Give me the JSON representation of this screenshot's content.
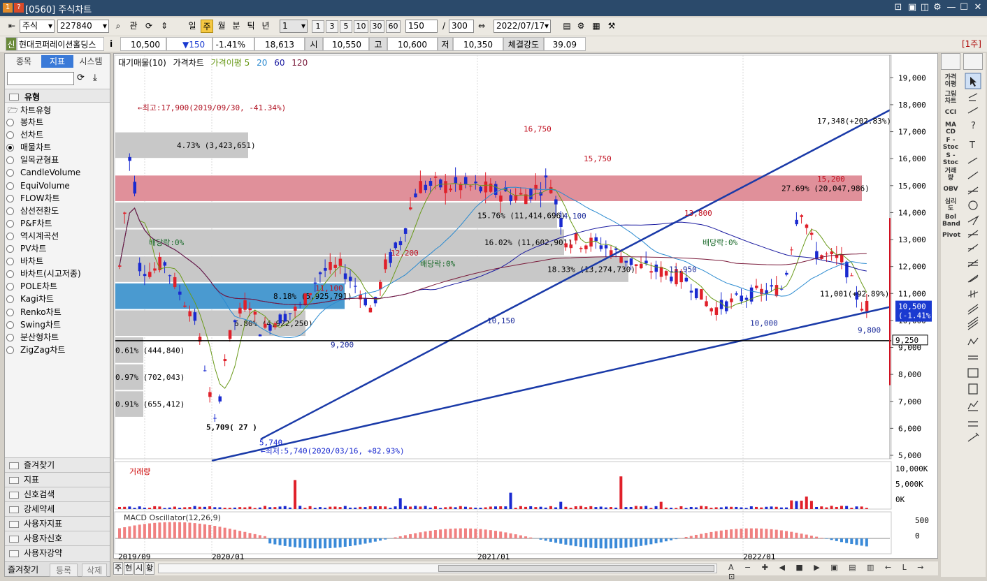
{
  "window": {
    "title": "[0560] 주식차트",
    "menu_icons": [
      "1",
      "?"
    ]
  },
  "toolbar": {
    "market": "주식",
    "code": "227840",
    "btn_gwan": "관",
    "periods": [
      "일",
      "주",
      "월",
      "분",
      "틱",
      "년"
    ],
    "active_period": "주",
    "interval_value": "1",
    "quick": [
      "1",
      "3",
      "5",
      "10",
      "30",
      "60"
    ],
    "count": "150",
    "total": "300",
    "date": "2022/07/17"
  },
  "quote": {
    "badge": "신",
    "name": "현대코퍼레이션홀딩스",
    "info": "i",
    "price": "10,500",
    "change": "▼150",
    "pct": "-1.41%",
    "volume": "18,613",
    "open_label": "시",
    "open": "10,550",
    "high_label": "고",
    "high": "10,600",
    "low_label": "저",
    "low": "10,350",
    "strength_label": "체결강도",
    "strength": "39.09",
    "period_badge": "[1주]"
  },
  "left": {
    "tabs": [
      "종목",
      "지표",
      "시스템"
    ],
    "active_tab": "지표",
    "section_title": "유형",
    "tree_root": "차트유형",
    "types": [
      "봉차트",
      "선차트",
      "매물차트",
      "일목균형표",
      "CandleVolume",
      "EquiVolume",
      "FLOW차트",
      "삼선전환도",
      "P&F차트",
      "역시계곡선",
      "PV차트",
      "바차트",
      "바차트(시고저종)",
      "POLE차트",
      "Kagi차트",
      "Renko차트",
      "Swing차트",
      "분산형차트",
      "ZigZag차트"
    ],
    "selected_type": "매물차트",
    "sections": [
      "즐겨찾기",
      "지표",
      "신호검색",
      "강세약세",
      "사용자지표",
      "사용자신호",
      "사용자강약"
    ],
    "bottom_tabs": [
      "즐겨찾기",
      "등록",
      "삭제"
    ]
  },
  "legend": {
    "items": [
      "대기매물(10)",
      "가격차트",
      "가격이평 5",
      "20",
      "60",
      "120"
    ],
    "colors": {
      "ma5": "#6a9a1a",
      "ma20": "#2a8ad0",
      "ma60": "#1a1aa0",
      "ma120": "#7a1a3a"
    }
  },
  "annotations": {
    "high": "←최고:17,900(2019/09/30, -41.34%)",
    "low": "←최저:5,740(2020/03/16, +82.93%)",
    "low_val": "5,740",
    "dividend": "배당락:0%",
    "labels": [
      "16,750",
      "15,750",
      "14,100",
      "12,200",
      "11,100",
      "9,200",
      "10,150",
      "13,800",
      "11,950",
      "10,000",
      "15,200",
      "9,800"
    ],
    "trend_top": "17,348(+202.83%)",
    "trend_low": "11,001(+92.89%)",
    "left_low": "5,709( 27 )",
    "horiz": "9,250",
    "cur_price": "10,500",
    "cur_pct": "(-1.41%)"
  },
  "volume_profile": [
    {
      "label": "4.73% (3,423,651)"
    },
    {
      "label": "27.69% (20,047,986)"
    },
    {
      "label": "15.76% (11,414,696)"
    },
    {
      "label": "16.02% (11,602,901)"
    },
    {
      "label": "18.33% (13,274,730)"
    },
    {
      "label": "8.18% (5,925,791)"
    },
    {
      "label": "6.80% (4,922,250)"
    },
    {
      "label": "0.61% (444,840)"
    },
    {
      "label": "0.97% (702,043)"
    },
    {
      "label": "0.91% (655,412)"
    }
  ],
  "price_axis": [
    "19,000",
    "18,000",
    "17,000",
    "16,000",
    "15,000",
    "14,000",
    "13,000",
    "12,000",
    "11,000",
    "10,000",
    "9,000",
    "8,000",
    "7,000",
    "6,000",
    "5,000"
  ],
  "volume_panel": {
    "title": "거래량",
    "axis": [
      "10,000K",
      "5,000K",
      "0K"
    ]
  },
  "macd_panel": {
    "title": "MACD Oscillator(12,26,9)",
    "axis": [
      "500",
      "0"
    ]
  },
  "x_axis": [
    "2019/09",
    "2020/01",
    "2021/01",
    "2022/01"
  ],
  "bottom": {
    "buttons": [
      "주",
      "현",
      "시",
      "황"
    ]
  },
  "chart_data": {
    "type": "candlestick",
    "x": [
      "2019/09",
      "2022/07"
    ],
    "y_range": [
      5000,
      19500
    ],
    "high": 17900,
    "low": 5740,
    "last": 10500
  }
}
